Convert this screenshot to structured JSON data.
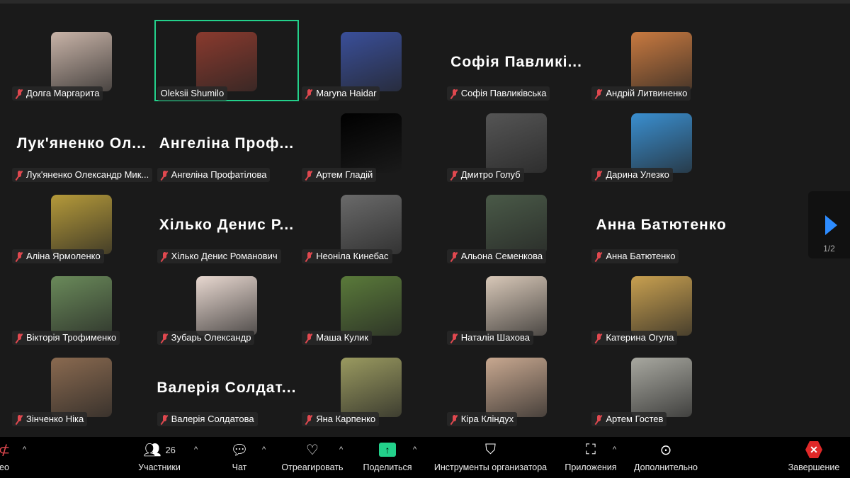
{
  "participants": [
    {
      "name": "Долга Маргарита",
      "muted": true,
      "photo": "#c9b4a8"
    },
    {
      "name": "Oleksii Shumilo",
      "muted": false,
      "active": true,
      "photo": "#8a3a2e"
    },
    {
      "name": "Maryna Haidar",
      "muted": true,
      "photo": "#3a4f9a"
    },
    {
      "name": "Софія Павликівська",
      "muted": true,
      "display": "Софія  Павликі..."
    },
    {
      "name": "Андрій Литвиненко",
      "muted": true,
      "photo": "#c97a40"
    },
    {
      "name": "Лук'яненко Олександр Мик...",
      "muted": true,
      "display": "Лук'яненко  Ол..."
    },
    {
      "name": "Ангеліна Профатілова",
      "muted": true,
      "display": "Ангеліна  Проф..."
    },
    {
      "name": "Артем Гладій",
      "muted": true,
      "photo": "#000000"
    },
    {
      "name": "Дмитро Голуб",
      "muted": true,
      "photo": "#555555"
    },
    {
      "name": "Дарина Улезко",
      "muted": true,
      "photo": "#3a8fd0"
    },
    {
      "name": "Аліна Ярмоленко",
      "muted": true,
      "photo": "#b59a3a"
    },
    {
      "name": "Хілько Денис Романович",
      "muted": true,
      "display": "Хілько  Денис  Р..."
    },
    {
      "name": "Неоніла Кинебас",
      "muted": true,
      "photo": "#6a6a6a"
    },
    {
      "name": "Альона Семенкова",
      "muted": true,
      "photo": "#4a5a48"
    },
    {
      "name": "Анна Батютенко",
      "muted": true,
      "display": "Анна  Батютенко"
    },
    {
      "name": "Вікторія Трофименко",
      "muted": true,
      "photo": "#6a8a5a"
    },
    {
      "name": "Зубарь Олександр",
      "muted": true,
      "photo": "#e8d8d0"
    },
    {
      "name": "Маша Кулик",
      "muted": true,
      "photo": "#5a7a3a"
    },
    {
      "name": "Наталія Шахова",
      "muted": true,
      "photo": "#d8c8b8"
    },
    {
      "name": "Катерина Огула",
      "muted": true,
      "photo": "#c8a050"
    },
    {
      "name": "Зінченко Ніка",
      "muted": true,
      "photo": "#8a6a50"
    },
    {
      "name": "Валерія Солдатова",
      "muted": true,
      "display": "Валерія  Солдат..."
    },
    {
      "name": "Яна Карпенко",
      "muted": true,
      "photo": "#9a9a60"
    },
    {
      "name": "Кіра Кліндух",
      "muted": true,
      "photo": "#c8a890"
    },
    {
      "name": "Артем Гостев",
      "muted": true,
      "photo": "#a8a8a0"
    }
  ],
  "pager": {
    "page": "1/2"
  },
  "toolbar": {
    "video": "ео",
    "participants": "Участники",
    "participants_count": "26",
    "chat": "Чат",
    "react": "Отреагировать",
    "share": "Поделиться",
    "host_tools": "Инструменты организатора",
    "apps": "Приложения",
    "more": "Дополнительно",
    "end": "Завершение"
  },
  "colors": {
    "active_border": "#23d18b",
    "share": "#23d18b",
    "end": "#e02828",
    "pager_arrow": "#2d8cff"
  }
}
